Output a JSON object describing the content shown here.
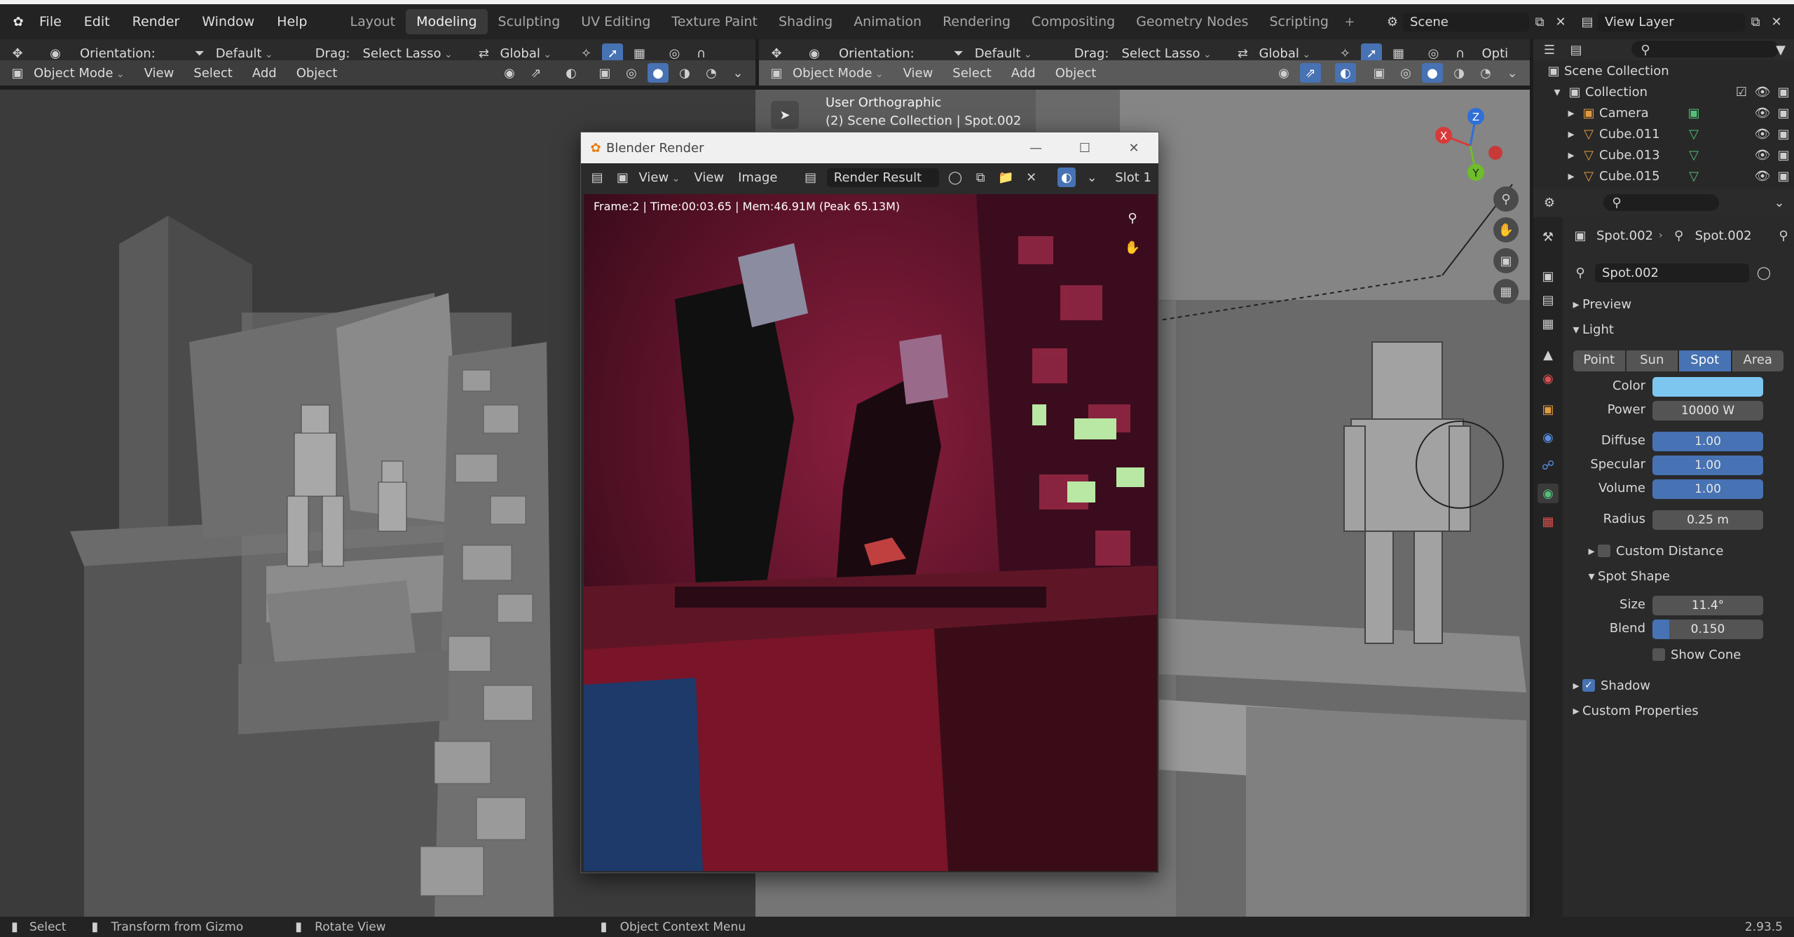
{
  "topbar": {
    "menus": [
      "File",
      "Edit",
      "Render",
      "Window",
      "Help"
    ],
    "workspaces": [
      "Layout",
      "Modeling",
      "Sculpting",
      "UV Editing",
      "Texture Paint",
      "Shading",
      "Animation",
      "Rendering",
      "Compositing",
      "Geometry Nodes",
      "Scripting"
    ],
    "active_workspace": "Modeling",
    "scene": "Scene",
    "view_layer": "View Layer"
  },
  "left_viewport": {
    "orientation_label": "Orientation:",
    "orientation_value": "Default",
    "drag_label": "Drag:",
    "drag_value": "Select Lasso",
    "transform": "Global",
    "mode": "Object Mode",
    "menu": [
      "View",
      "Select",
      "Add",
      "Object"
    ]
  },
  "right_viewport": {
    "orientation_label": "Orientation:",
    "orientation_value": "Default",
    "drag_label": "Drag:",
    "drag_value": "Select Lasso",
    "transform": "Global",
    "options": "Opti",
    "mode": "Object Mode",
    "menu": [
      "View",
      "Select",
      "Add",
      "Object"
    ],
    "view_name": "User Orthographic",
    "view_info": "(2) Scene Collection | Spot.002",
    "gizmo": {
      "x": "X",
      "y": "Y",
      "z": "Z"
    }
  },
  "render_window": {
    "title": "Blender Render",
    "menu": [
      "View",
      "View",
      "Image"
    ],
    "image_name": "Render Result",
    "slot": "Slot 1",
    "stats": "Frame:2 | Time:00:03.65 | Mem:46.91M (Peak 65.13M)"
  },
  "outliner": {
    "root": "Scene Collection",
    "collection": "Collection",
    "items": [
      "Camera",
      "Cube.011",
      "Cube.013",
      "Cube.015"
    ]
  },
  "properties": {
    "object_name": "Spot.002",
    "data_name": "Spot.002",
    "datablock": "Spot.002",
    "preview": "Preview",
    "light_panel": "Light",
    "light_types": [
      "Point",
      "Sun",
      "Spot",
      "Area"
    ],
    "active_light_type": "Spot",
    "color_label": "Color",
    "color_value": "#7dc6f0",
    "power_label": "Power",
    "power": "10000 W",
    "diffuse_label": "Diffuse",
    "diffuse": "1.00",
    "specular_label": "Specular",
    "specular": "1.00",
    "volume_label": "Volume",
    "volume": "1.00",
    "radius_label": "Radius",
    "radius": "0.25 m",
    "custom_distance": "Custom Distance",
    "spot_shape": "Spot Shape",
    "size_label": "Size",
    "size": "11.4°",
    "blend_label": "Blend",
    "blend": "0.150",
    "blend_fraction": 0.15,
    "show_cone": "Show Cone",
    "shadow": "Shadow",
    "custom_properties": "Custom Properties"
  },
  "statusbar": {
    "select": "Select",
    "transform": "Transform from Gizmo",
    "rotate": "Rotate View",
    "context": "Object Context Menu",
    "version": "2.93.5"
  }
}
